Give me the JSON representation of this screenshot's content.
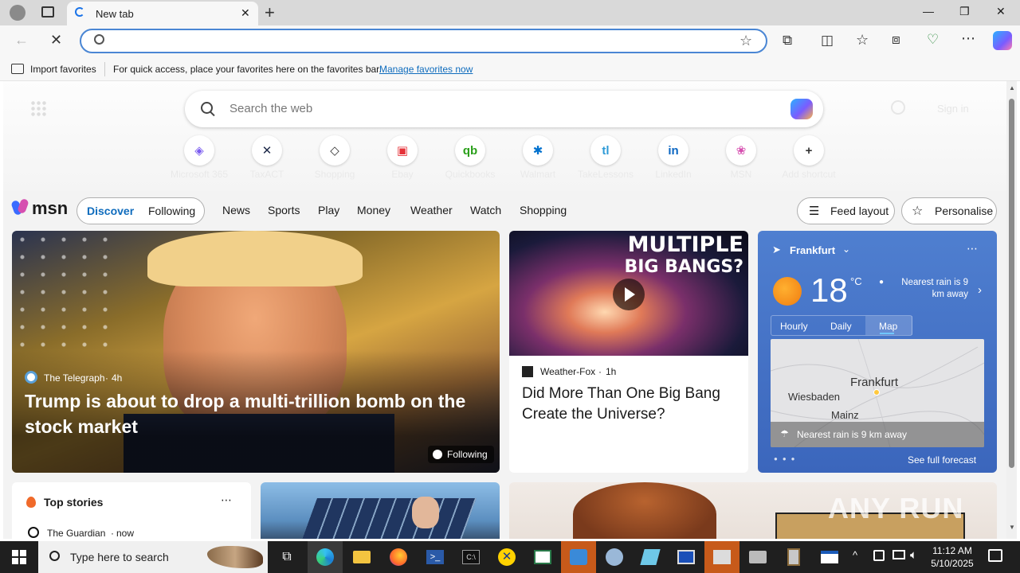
{
  "tabbar": {
    "tab_title": "New tab",
    "new_tab_glyph": "+",
    "window_controls": {
      "minimize": "—",
      "restore": "❐",
      "close": "✕"
    }
  },
  "navbar": {
    "address_value": "",
    "icons": [
      "back-arrow-icon",
      "loading-stop-icon",
      "search-icon",
      "favorite-star-icon",
      "extensions-icon",
      "split-screen-icon",
      "favorites-icon",
      "collections-icon",
      "browser-essentials-icon",
      "more-icon",
      "copilot-icon"
    ]
  },
  "favorites_bar": {
    "import_label": "Import favorites",
    "message": "For quick access, place your favorites here on the favorites bar.",
    "manage_link": "Manage favorites now"
  },
  "newtab": {
    "search_placeholder": "Search the web",
    "sign_in": "Sign in",
    "shortcuts": [
      {
        "label": "Microsoft 365",
        "glyph": "◈",
        "color": "#7b5cf0"
      },
      {
        "label": "TaxACT",
        "glyph": "✕",
        "color": "#1e2a4a"
      },
      {
        "label": "Shopping",
        "glyph": "◇",
        "color": "#333333"
      },
      {
        "label": "Ebay",
        "glyph": "▣",
        "color": "#e53238"
      },
      {
        "label": "Quickbooks",
        "glyph": "qb",
        "color": "#2ca01c"
      },
      {
        "label": "Walmart",
        "glyph": "✱",
        "color": "#0071ce"
      },
      {
        "label": "TakeLessons",
        "glyph": "tl",
        "color": "#2f9bd7"
      },
      {
        "label": "LinkedIn",
        "glyph": "in",
        "color": "#0a66c2"
      },
      {
        "label": "MSN",
        "glyph": "❀",
        "color": "#d64fb0"
      },
      {
        "label": "Add shortcut",
        "glyph": "+",
        "color": "#333333"
      }
    ]
  },
  "msn": {
    "logo_text": "msn",
    "tabs": [
      "Discover",
      "Following"
    ],
    "nav": [
      "News",
      "Sports",
      "Play",
      "Money",
      "Weather",
      "Watch",
      "Shopping"
    ],
    "feed_layout": "Feed layout",
    "personalise": "Personalise"
  },
  "main_story": {
    "source": "The Telegraph",
    "time": "4h",
    "headline": "Trump is about to drop a multi-trillion bomb on the stock market",
    "following_badge": "Following"
  },
  "video_story": {
    "thumb_text_line1": "MULTIPLE",
    "thumb_text_line2": "BIG BANGS?",
    "source": "Weather-Fox",
    "time": "1h",
    "headline": "Did More Than One Big Bang Create the Universe?"
  },
  "weather": {
    "location": "Frankfurt",
    "temperature": "18",
    "unit": "°C",
    "rain_note": "Nearest rain is 9 km away",
    "tabs": [
      "Hourly",
      "Daily",
      "Map"
    ],
    "active_tab": "Map",
    "map_labels": [
      "Frankfurt",
      "Wiesbaden",
      "Mainz"
    ],
    "map_footer": "Nearest rain is 9 km away",
    "see_full": "See full forecast"
  },
  "top_stories": {
    "title": "Top stories",
    "first_source": "The Guardian",
    "first_time": "now"
  },
  "watermark": "ANY RUN",
  "taskbar": {
    "search_placeholder": "Type here to search",
    "time": "11:12 AM",
    "date": "5/10/2025"
  },
  "colors": {
    "accent": "#0f6cbd",
    "weather_bg": "#3e6fc6",
    "taskbar": "#1f1f1f"
  }
}
